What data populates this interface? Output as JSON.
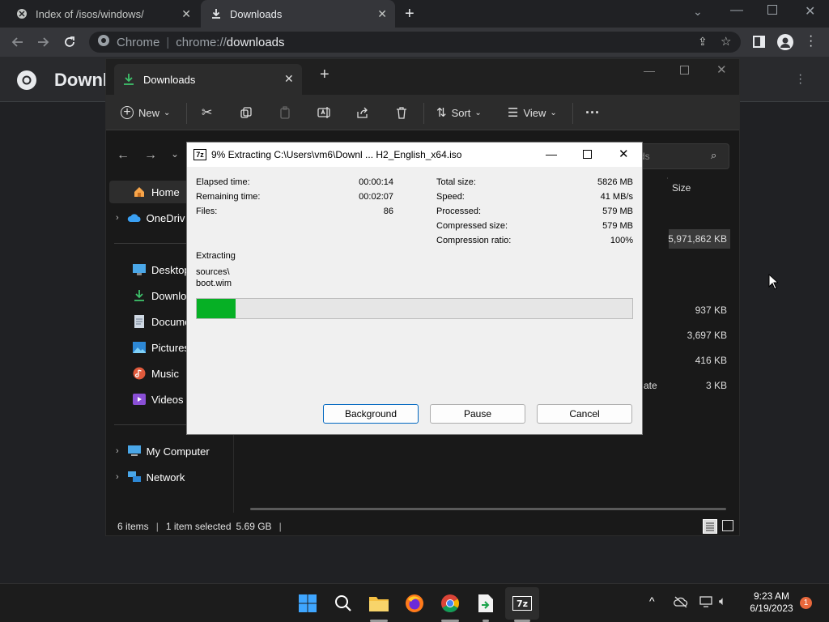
{
  "chrome": {
    "tabs": [
      {
        "title": "Index of /isos/windows/",
        "active": false
      },
      {
        "title": "Downloads",
        "active": true
      }
    ],
    "omnibox": {
      "chip": "Chrome",
      "scheme": "chrome://",
      "host": "downloads"
    },
    "page_title": "Downl"
  },
  "explorer": {
    "tab_title": "Downloads",
    "commands": {
      "new": "New",
      "sort": "Sort",
      "view": "View"
    },
    "search_placeholder": "ds",
    "column_size": "Size",
    "sidebar": [
      {
        "label": "Home",
        "icon": "home-icon",
        "selected": true,
        "expand": false
      },
      {
        "label": "OneDriv",
        "icon": "cloud-icon",
        "selected": false,
        "expand": true
      },
      {
        "label": "Desktop",
        "icon": "desktop-icon",
        "selected": false,
        "expand": false
      },
      {
        "label": "Downloa",
        "icon": "download-icon",
        "selected": false,
        "expand": false
      },
      {
        "label": "Docume",
        "icon": "document-icon",
        "selected": false,
        "expand": false
      },
      {
        "label": "Pictures",
        "icon": "pictures-icon",
        "selected": false,
        "expand": false
      },
      {
        "label": "Music",
        "icon": "music-icon",
        "selected": false,
        "expand": false
      },
      {
        "label": "Videos",
        "icon": "videos-icon",
        "selected": false,
        "expand": false
      },
      {
        "label": "My Computer",
        "icon": "computer-icon",
        "selected": false,
        "expand": true
      },
      {
        "label": "Network",
        "icon": "network-icon",
        "selected": false,
        "expand": true
      }
    ],
    "file_sizes": [
      "5,971,862 KB",
      "937 KB",
      "3,697 KB",
      "416 KB",
      "3 KB"
    ],
    "partial_name": "ate",
    "status": {
      "items": "6 items",
      "selected": "1 item selected",
      "size": "5.69 GB"
    }
  },
  "dialog": {
    "title": "9% Extracting C:\\Users\\vm6\\Downl ... H2_English_x64.iso",
    "left_stats": [
      {
        "label": "Elapsed time:",
        "value": "00:00:14"
      },
      {
        "label": "Remaining time:",
        "value": "00:02:07"
      },
      {
        "label": "Files:",
        "value": "86"
      }
    ],
    "right_stats": [
      {
        "label": "Total size:",
        "value": "5826 MB"
      },
      {
        "label": "Speed:",
        "value": "41 MB/s"
      },
      {
        "label": "Processed:",
        "value": "579 MB"
      },
      {
        "label": "Compressed size:",
        "value": "579 MB"
      },
      {
        "label": "Compression ratio:",
        "value": "100%"
      }
    ],
    "action": "Extracting",
    "path_line1": "sources\\",
    "path_line2": "boot.wim",
    "progress_percent": 9,
    "buttons": {
      "background": "Background",
      "pause": "Pause",
      "cancel": "Cancel"
    }
  },
  "taskbar": {
    "time": "9:23 AM",
    "date": "6/19/2023",
    "notification_count": "1"
  }
}
